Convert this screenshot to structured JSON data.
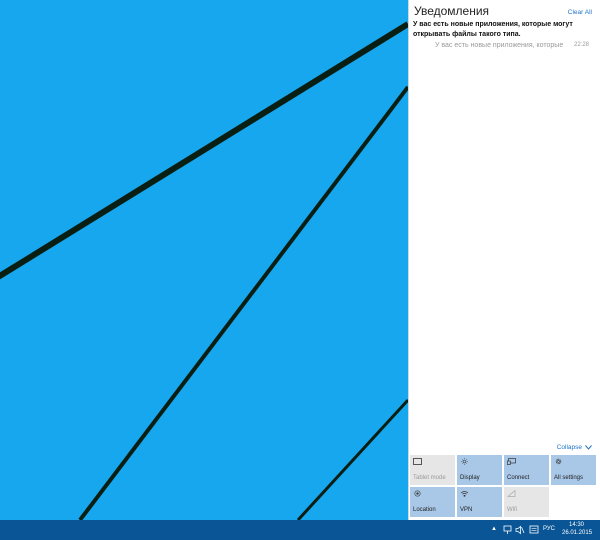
{
  "action_center": {
    "title": "Уведомления",
    "clear_all": "Clear All",
    "notification": {
      "header": "У вас есть новые приложения, которые могут открывать файлы такого типа.",
      "item_text": "У вас есть новые приложения, которые",
      "item_time": "22:28"
    },
    "collapse_label": "Collapse",
    "quick_actions": [
      {
        "label": "Tablet mode",
        "icon": "tablet-mode-icon",
        "state": "off"
      },
      {
        "label": "Display",
        "icon": "brightness-icon",
        "state": "on"
      },
      {
        "label": "Connect",
        "icon": "connect-icon",
        "state": "on"
      },
      {
        "label": "All settings",
        "icon": "gear-icon",
        "state": "on"
      },
      {
        "label": "Location",
        "icon": "location-icon",
        "state": "on"
      },
      {
        "label": "VPN",
        "icon": "vpn-icon",
        "state": "on"
      },
      {
        "label": "Wifi",
        "icon": "wifi-icon",
        "state": "off"
      }
    ]
  },
  "taskbar": {
    "tray_chevron": "▲",
    "language": "РУС",
    "time": "14:30",
    "date": "26.01.2015"
  },
  "colors": {
    "desktop_bg": "#16a7ef",
    "taskbar_bg": "#0a5596",
    "tile_on": "#a9c8e8",
    "tile_off": "#e6e6e6",
    "link": "#1e73c8"
  }
}
